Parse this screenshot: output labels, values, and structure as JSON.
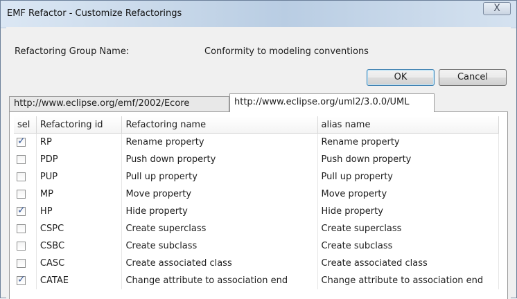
{
  "window": {
    "title": "EMF Refactor - Customize Refactorings",
    "close_glyph": "X"
  },
  "group": {
    "label": "Refactoring Group Name:",
    "value": "Conformity to modeling conventions"
  },
  "buttons": {
    "ok": "OK",
    "cancel": "Cancel"
  },
  "tabs": [
    {
      "label": "http://www.eclipse.org/emf/2002/Ecore",
      "active": false
    },
    {
      "label": "http://www.eclipse.org/uml2/3.0.0/UML",
      "active": true
    }
  ],
  "table": {
    "columns": [
      "sel",
      "Refactoring id",
      "Refactoring name",
      "alias name"
    ],
    "rows": [
      {
        "sel": true,
        "id": "RP",
        "name": "Rename property",
        "alias": "Rename property"
      },
      {
        "sel": false,
        "id": "PDP",
        "name": "Push down property",
        "alias": "Push down property"
      },
      {
        "sel": false,
        "id": "PUP",
        "name": "Pull up property",
        "alias": "Pull up property"
      },
      {
        "sel": false,
        "id": "MP",
        "name": "Move property",
        "alias": "Move property"
      },
      {
        "sel": true,
        "id": "HP",
        "name": "Hide property",
        "alias": "Hide property"
      },
      {
        "sel": false,
        "id": "CSPC",
        "name": "Create superclass",
        "alias": "Create superclass"
      },
      {
        "sel": false,
        "id": "CSBC",
        "name": "Create subclass",
        "alias": "Create subclass"
      },
      {
        "sel": false,
        "id": "CASC",
        "name": "Create associated class",
        "alias": "Create associated class"
      },
      {
        "sel": true,
        "id": "CATAE",
        "name": "Change attribute to association end",
        "alias": "Change attribute to association end"
      }
    ]
  }
}
